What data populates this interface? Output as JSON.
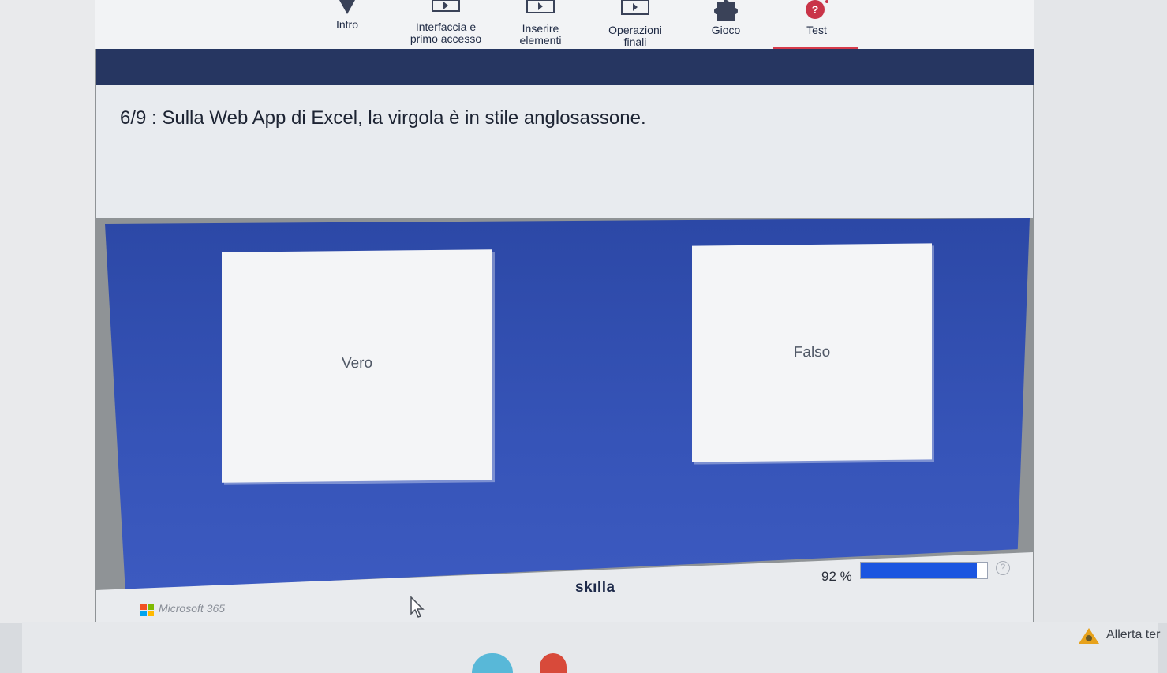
{
  "nav": {
    "items": [
      {
        "label": "Intro",
        "icon": "map-pin-icon"
      },
      {
        "label": "Interfaccia e\nprimo accesso",
        "icon": "video-icon"
      },
      {
        "label": "Inserire\nelementi",
        "icon": "video-icon"
      },
      {
        "label": "Operazioni\nfinali",
        "icon": "video-icon"
      },
      {
        "label": "Gioco",
        "icon": "puzzle-icon"
      },
      {
        "label": "Test",
        "icon": "question-bubble-icon"
      }
    ],
    "active": "Test"
  },
  "question": {
    "text": "6/9 : Sulla Web App di Excel, la virgola è in stile anglosassone."
  },
  "answers": [
    {
      "label": "Vero"
    },
    {
      "label": "Falso"
    }
  ],
  "footer": {
    "brand": "skılla",
    "progress_text": "92 %",
    "progress_value": 0.92,
    "help": "?"
  },
  "microsoft": {
    "text": "Microsoft 365"
  },
  "system": {
    "alert_text": "Allerta ter"
  },
  "colors": {
    "navy_band": "#263661",
    "panel_blue": "#3654b8",
    "accent_red": "#d63a4a",
    "progress_blue": "#1a55e0"
  }
}
